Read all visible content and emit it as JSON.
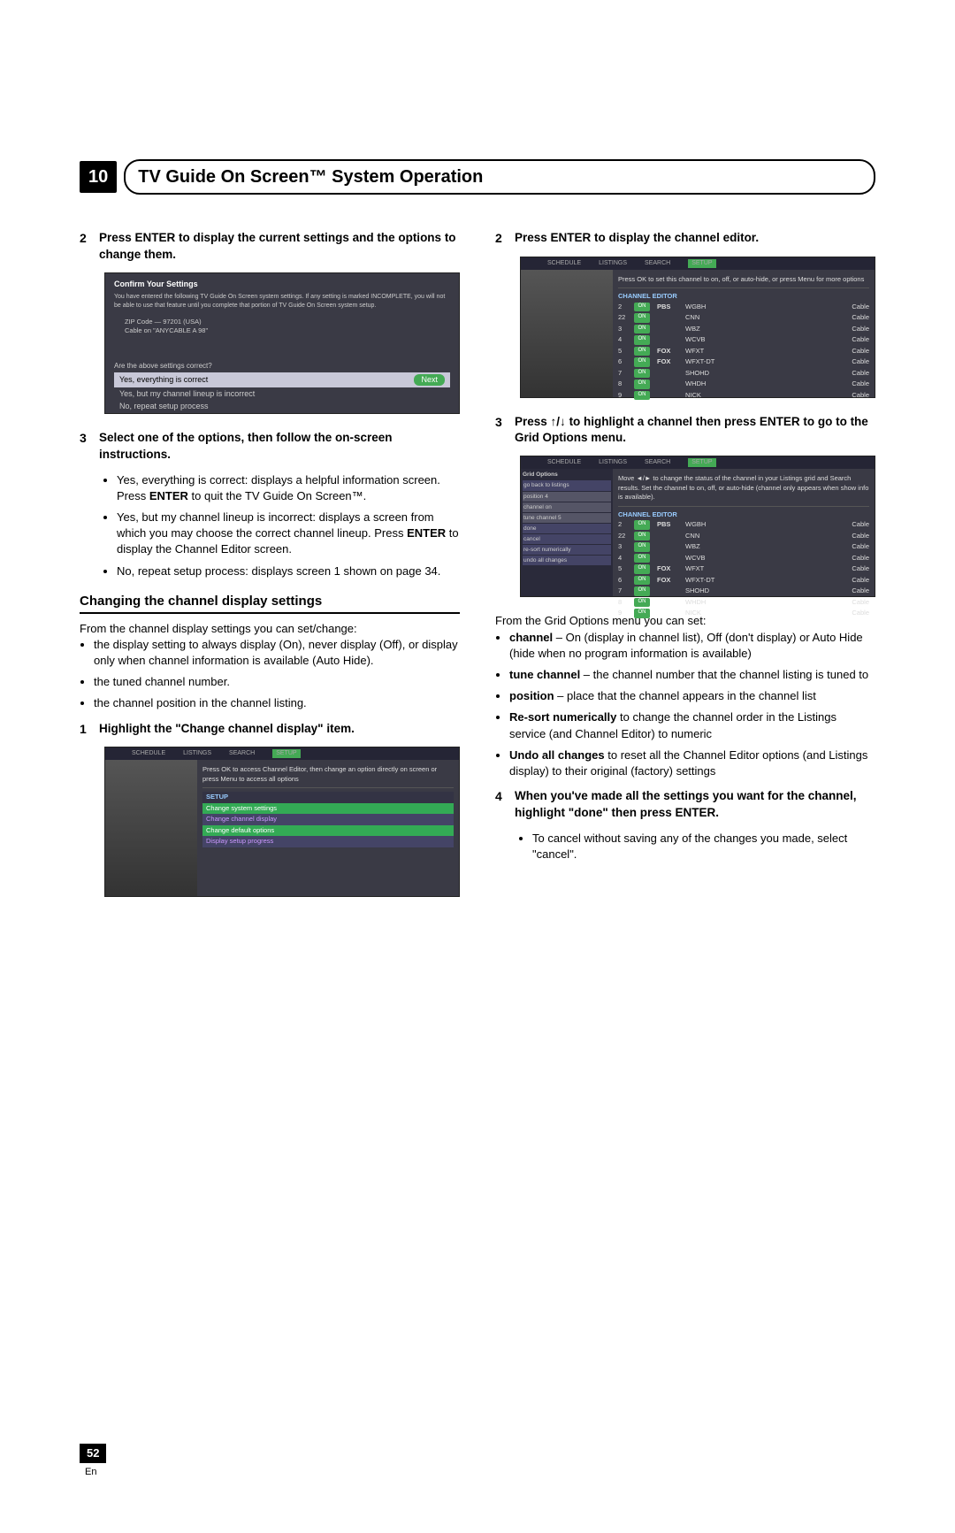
{
  "chapter": {
    "number": "10",
    "title": "TV Guide On Screen™ System Operation"
  },
  "left": {
    "step2": "Press ENTER to display the current settings and the options to change them.",
    "shot1": {
      "title": "Confirm Your Settings",
      "text1": "You have entered the following TV Guide On Screen system settings. If any setting is marked INCOMPLETE, you will not be able to use that feature until you complete that portion of TV Guide On Screen system setup.",
      "zip": "ZIP Code — 97201 (USA)",
      "cable": "Cable on \"ANYCABLE A 98\"",
      "q": "Are the above settings correct?",
      "opt1": "Yes, everything is correct",
      "opt2": "Yes, but my channel lineup is incorrect",
      "opt3": "No, repeat setup process",
      "next": "Next"
    },
    "step3": "Select one of the options, then follow the on-screen instructions.",
    "s3b1a": "Yes, everything is correct: displays a helpful information screen. Press ",
    "s3b1b": "ENTER",
    "s3b1c": " to quit the TV Guide On Screen™.",
    "s3b2a": "Yes, but my channel lineup is incorrect: displays a screen from which you may choose the correct channel lineup. Press ",
    "s3b2b": "ENTER",
    "s3b2c": " to display the Channel Editor screen.",
    "s3b3": "No, repeat setup process: displays screen 1 shown on page 34.",
    "sect": "Changing the channel display settings",
    "intro": "From the channel display settings you can set/change:",
    "i1": "the display setting to always display (On), never display (Off), or display only when channel information is available (Auto Hide).",
    "i2": "the tuned channel number.",
    "i3": "the channel position in the channel listing.",
    "step1": "Highlight the \"Change channel display\" item.",
    "shot2": {
      "tip": "Press OK to access Channel Editor, then change an option directly on screen or press Menu to access all options",
      "setup": "SETUP",
      "m1": "Change system settings",
      "m2": "Change channel display",
      "m3": "Change default options",
      "m4": "Display setup progress"
    }
  },
  "right": {
    "step2": "Press ENTER to display the channel editor.",
    "shot3": {
      "tip": "Press OK to set this channel to on, off, or auto-hide, or press Menu for more options",
      "hdr": "CHANNEL EDITOR",
      "rows": [
        [
          "2",
          "ON",
          "PBS",
          "WGBH",
          "Cable"
        ],
        [
          "22",
          "ON",
          "",
          "CNN",
          "Cable"
        ],
        [
          "3",
          "ON",
          "",
          "WBZ",
          "Cable"
        ],
        [
          "4",
          "ON",
          "",
          "WCVB",
          "Cable"
        ],
        [
          "5",
          "ON",
          "FOX",
          "WFXT",
          "Cable"
        ],
        [
          "6",
          "ON",
          "FOX",
          "WFXT-DT",
          "Cable"
        ],
        [
          "7",
          "ON",
          "",
          "SHOHD",
          "Cable"
        ],
        [
          "8",
          "ON",
          "",
          "WHDH",
          "Cable"
        ],
        [
          "9",
          "ON",
          "",
          "NICK",
          "Cable"
        ]
      ]
    },
    "step3a": "Press ",
    "step3b": " to highlight a channel then press ENTER to go to the Grid Options menu.",
    "shot4": {
      "tip": "Move ◄/► to change the status of the channel in your Listings grid and Search results. Set the channel to on, off, or auto-hide (channel only appears when show info is available).",
      "side": "Grid Options",
      "s1": "go back to listings",
      "s2": "position   4",
      "s3": "channel   on",
      "s4": "tune channel   5",
      "s5": "done",
      "s6": "cancel",
      "s7": "re-sort numerically",
      "s8": "undo all changes"
    },
    "intro": "From the Grid Options menu you can set:",
    "b1a": "channel",
    "b1b": " – On (display in channel list), Off (don't display) or Auto Hide (hide when no program information is available)",
    "b2a": "tune channel",
    "b2b": " – the channel number that the channel listing is tuned to",
    "b3a": "position",
    "b3b": " – place that the channel appears in the channel list",
    "b4a": "Re-sort numerically",
    "b4b": " to change the channel order in the Listings service (and Channel Editor) to numeric",
    "b5a": "Undo all changes",
    "b5b": " to reset all the Channel Editor options (and Listings display) to their original (factory) settings",
    "step4": "When you've made all the settings you want for the channel, highlight \"done\" then press ENTER.",
    "s4b1": "To cancel without saving any of the changes you made, select \"cancel\"."
  },
  "page": {
    "num": "52",
    "lang": "En"
  },
  "tabs": [
    "SCHEDULE",
    "LISTINGS",
    "SEARCH",
    "SETUP"
  ]
}
